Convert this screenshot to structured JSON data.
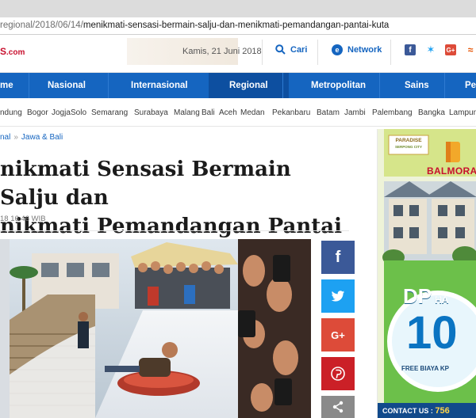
{
  "browser": {
    "address_url_dim": "regional/2018/06/14/",
    "address_url_path": "menikmati-sensasi-bermain-salju-dan-menikmati-pemandangan-pantai-kuta"
  },
  "header": {
    "logo_text": "S",
    "logo_suffix": ".com",
    "date": "Kamis, 21 Juni 2018",
    "search_label": "Cari",
    "network_label": "Network"
  },
  "nav": {
    "items": [
      "me",
      "Nasional",
      "Internasional",
      "Regional",
      "Metropolitan",
      "Sains",
      "Pe"
    ],
    "active": "Regional"
  },
  "cities": [
    "ndung",
    "Bogor",
    "Jogja",
    "Solo",
    "Semarang",
    "Surabaya",
    "Malang",
    "Bali",
    "Aceh",
    "Medan",
    "Pekanbaru",
    "Batam",
    "Jambi",
    "Palembang",
    "Bangka",
    "Lampung"
  ],
  "article": {
    "breadcrumb_prev": "nal",
    "breadcrumb_current": "Jawa & Bali",
    "headline_line1": "nikmati Sensasi Bermain Salju dan",
    "headline_line2": "nikmati Pemandangan Pantai Kuta",
    "timestamp": "18 16:46 WIB"
  },
  "share": {
    "facebook": "f",
    "twitter": "t",
    "googleplus": "G+",
    "pinterest": "P",
    "more": "<"
  },
  "ad": {
    "badge_line1": "PARADISE",
    "badge_line2": "SERPONG CITY",
    "brand": "BALMORA",
    "dp_text": "DP",
    "dp_suffix": "HA",
    "big_number": "10",
    "free_text": "FREE BIAYA KP",
    "contact_text": "CONTACT US :",
    "contact_number": "756"
  },
  "colors": {
    "nav_blue": "#1565c0",
    "facebook": "#3b5998",
    "twitter": "#1da1f2",
    "googleplus": "#dd4b39",
    "pinterest": "#cb2027",
    "more": "#8a8a8a"
  }
}
